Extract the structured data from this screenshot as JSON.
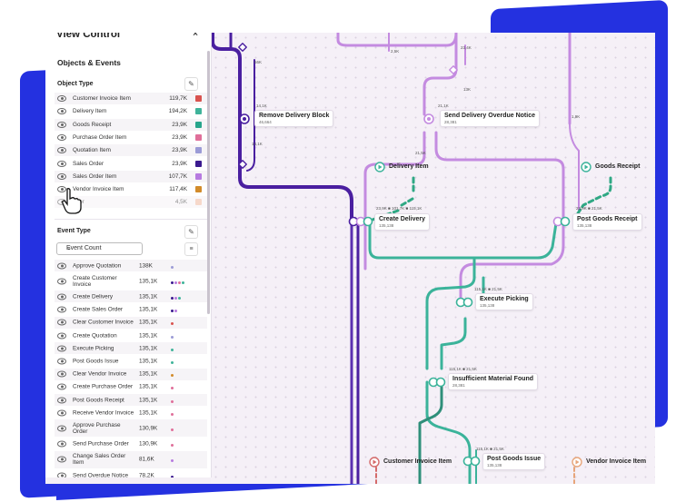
{
  "panel": {
    "title": "View Control",
    "close_icon": "×",
    "section_title": "Objects & Events",
    "object_type_title": "Object Type",
    "event_type_title": "Event Type",
    "event_select": "Event Count",
    "object_types": [
      {
        "label": "Customer Invoice Item",
        "count": "119,7K",
        "color": "#d9534f"
      },
      {
        "label": "Delivery Item",
        "count": "194,2K",
        "color": "#3fb39a"
      },
      {
        "label": "Goods Receipt",
        "count": "23,9K",
        "color": "#28a58c"
      },
      {
        "label": "Purchase Order Item",
        "count": "23,9K",
        "color": "#e06f9a"
      },
      {
        "label": "Quotation Item",
        "count": "23,9K",
        "color": "#9b9bd6"
      },
      {
        "label": "Sales Order",
        "count": "23,9K",
        "color": "#3b1a8f"
      },
      {
        "label": "Sales Order Item",
        "count": "107,7K",
        "color": "#b77be0"
      },
      {
        "label": "Vendor Invoice Item",
        "count": "117,4K",
        "color": "#d28b2a"
      },
      {
        "label": "ndor",
        "count": "4,5K",
        "color": "#f0b9a0"
      }
    ],
    "event_types": [
      {
        "label": "Approve Quotation",
        "count": "138K",
        "h": 13,
        "dots": [
          "#9b9bd6"
        ]
      },
      {
        "label": "Create Customer Invoice",
        "count": "135,1K",
        "h": 19,
        "dots": [
          "#3b1a8f",
          "#b77be0",
          "#e06f9a",
          "#3fb39a"
        ]
      },
      {
        "label": "Create Delivery",
        "count": "135,1K",
        "h": 13,
        "dots": [
          "#3b1a8f",
          "#b77be0",
          "#3fb39a"
        ]
      },
      {
        "label": "Create Sales Order",
        "count": "135,1K",
        "h": 13,
        "dots": [
          "#3b1a8f",
          "#b77be0"
        ]
      },
      {
        "label": "Clear Customer Invoice",
        "count": "135,1K",
        "h": 13,
        "dots": [
          "#d9534f"
        ]
      },
      {
        "label": "Create Quotation",
        "count": "135,1K",
        "h": 13,
        "dots": [
          "#9b9bd6"
        ]
      },
      {
        "label": "Execute Picking",
        "count": "135,1K",
        "h": 13,
        "dots": [
          "#3fb39a"
        ]
      },
      {
        "label": "Post Goods Issue",
        "count": "135,1K",
        "h": 13,
        "dots": [
          "#3fb39a"
        ]
      },
      {
        "label": "Clear Vendor Invoice",
        "count": "135,1K",
        "h": 13,
        "dots": [
          "#d28b2a"
        ]
      },
      {
        "label": "Create Purchase Order",
        "count": "135,1K",
        "h": 13,
        "dots": [
          "#e06f9a"
        ]
      },
      {
        "label": "Post Goods Receipt",
        "count": "135,1K",
        "h": 13,
        "dots": [
          "#e06f9a"
        ]
      },
      {
        "label": "Receive Vendor Invoice",
        "count": "135,1K",
        "h": 13,
        "dots": [
          "#e06f9a"
        ]
      },
      {
        "label": "Approve Purchase Order",
        "count": "130,9K",
        "h": 19,
        "dots": [
          "#e06f9a"
        ]
      },
      {
        "label": "Send Purchase Order",
        "count": "130,9K",
        "h": 13,
        "dots": [
          "#e06f9a"
        ]
      },
      {
        "label": "Change Sales Order Item",
        "count": "81,6K",
        "h": 19,
        "dots": [
          "#b77be0"
        ]
      },
      {
        "label": "Send Overdue Notice",
        "count": "78,2K",
        "h": 13,
        "dots": [
          "#3b1a8f"
        ]
      }
    ]
  },
  "graph": {
    "nodes": [
      {
        "title": "Remove Delivery Block",
        "sub": "46,664"
      },
      {
        "title": "Send Delivery Overdue Notice",
        "sub": "28,381"
      },
      {
        "title": "Create Delivery",
        "sub": "135,138"
      },
      {
        "title": "Post Goods Receipt",
        "sub": "135,138"
      },
      {
        "title": "Execute Picking",
        "sub": "135,138"
      },
      {
        "title": "Insufficient Material Found",
        "sub": "28,381"
      },
      {
        "title": "Post Goods Issue",
        "sub": "135,138"
      }
    ],
    "object_labels": [
      {
        "label": "Delivery Item"
      },
      {
        "label": "Goods Receipt"
      },
      {
        "label": "Customer Invoice Item"
      },
      {
        "label": "Vendor Invoice Item"
      }
    ],
    "edge_labels": {
      "e1": "56K",
      "e2": "14,1K",
      "e3": "14,1K",
      "e4": "2,5K",
      "e5": "23,4K",
      "e6": "1,9K",
      "e7": "21,1K",
      "e8": "13K",
      "e9": "21,5K",
      "create_delivery": "23,9K ■ 101,7K ■ 115,1K",
      "goods_receipt": "23,9K ■ 21,5K",
      "picking": "115,1K ■ 21,5K",
      "insufficient": "115,1K ■ 21,5K",
      "goods_issue": "115,1K ■ 21,5K"
    }
  }
}
